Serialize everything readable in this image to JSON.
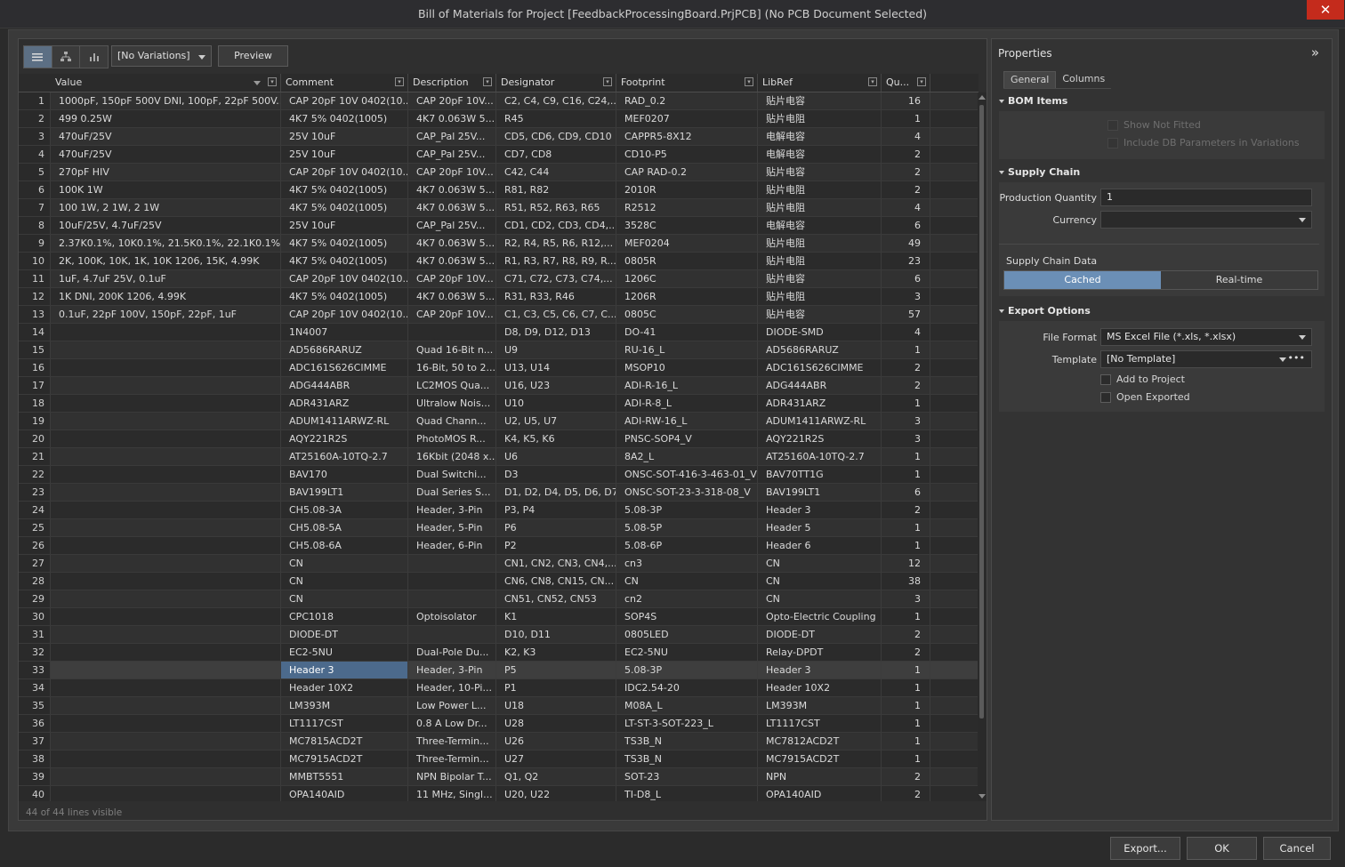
{
  "window": {
    "title": "Bill of Materials for Project [FeedbackProcessingBoard.PrjPCB] (No PCB Document Selected)",
    "close": "✕"
  },
  "toolbar": {
    "variation": "[No Variations]",
    "preview": "Preview"
  },
  "grid": {
    "columns": [
      "Value",
      "Comment",
      "Description",
      "Designator",
      "Footprint",
      "LibRef",
      "Qu..."
    ],
    "rows": [
      [
        "1",
        "1000pF, 150pF 500V DNI, 100pF, 22pF 500V...",
        "CAP 20pF 10V 0402(10...",
        "CAP 20pF 10V...",
        "C2, C4, C9, C16, C24,...",
        "RAD_0.2",
        "贴片电容",
        "16"
      ],
      [
        "2",
        "499 0.25W",
        "4K7 5% 0402(1005)",
        "4K7 0.063W 5...",
        "R45",
        "MEF0207",
        "贴片电阻",
        "1"
      ],
      [
        "3",
        "470uF/25V",
        "25V 10uF",
        "CAP_Pal  25V...",
        "CD5, CD6, CD9, CD10",
        "CAPPR5-8X12",
        "电解电容",
        "4"
      ],
      [
        "4",
        "470uF/25V",
        "25V 10uF",
        "CAP_Pal  25V...",
        "CD7, CD8",
        "CD10-P5",
        "电解电容",
        "2"
      ],
      [
        "5",
        "270pF HIV",
        "CAP 20pF 10V 0402(10...",
        "CAP 20pF 10V...",
        "C42, C44",
        "CAP RAD-0.2",
        "贴片电容",
        "2"
      ],
      [
        "6",
        "100K 1W",
        "4K7 5% 0402(1005)",
        "4K7 0.063W 5...",
        "R81, R82",
        "2010R",
        "贴片电阻",
        "2"
      ],
      [
        "7",
        "100 1W, 2  1W, 2 1W",
        "4K7 5% 0402(1005)",
        "4K7 0.063W 5...",
        "R51, R52, R63, R65",
        "R2512",
        "贴片电阻",
        "4"
      ],
      [
        "8",
        "10uF/25V, 4.7uF/25V",
        "25V 10uF",
        "CAP_Pal  25V...",
        "CD1, CD2, CD3, CD4,...",
        "3528C",
        "电解电容",
        "6"
      ],
      [
        "9",
        "2.37K0.1%, 10K0.1%, 21.5K0.1%, 22.1K0.1%, 2...",
        "4K7 5% 0402(1005)",
        "4K7 0.063W 5...",
        "R2, R4, R5, R6, R12,...",
        "MEF0204",
        "贴片电阻",
        "49"
      ],
      [
        "10",
        "2K, 100K, 10K, 1K, 10K  1206, 15K, 4.99K",
        "4K7 5% 0402(1005)",
        "4K7 0.063W 5...",
        "R1, R3, R7, R8, R9, R...",
        "0805R",
        "贴片电阻",
        "23"
      ],
      [
        "11",
        "1uF, 4.7uF 25V, 0.1uF",
        "CAP 20pF 10V 0402(10...",
        "CAP 20pF 10V...",
        "C71, C72, C73, C74,...",
        "1206C",
        "贴片电容",
        "6"
      ],
      [
        "12",
        "1K   DNI, 200K 1206, 4.99K",
        "4K7 5% 0402(1005)",
        "4K7 0.063W 5...",
        "R31, R33, R46",
        "1206R",
        "贴片电阻",
        "3"
      ],
      [
        "13",
        "0.1uF, 22pF 100V, 150pF, 22pF, 1uF",
        "CAP 20pF 10V 0402(10...",
        "CAP 20pF 10V...",
        "C1, C3, C5, C6, C7, C...",
        "0805C",
        "贴片电容",
        "57"
      ],
      [
        "14",
        "",
        "1N4007",
        "",
        "D8, D9, D12, D13",
        "DO-41",
        "DIODE-SMD",
        "4"
      ],
      [
        "15",
        "",
        "AD5686RARUZ",
        "Quad 16-Bit n...",
        "U9",
        "RU-16_L",
        "AD5686RARUZ",
        "1"
      ],
      [
        "16",
        "",
        "ADC161S626CIMME",
        "16-Bit, 50 to 2...",
        "U13, U14",
        "MSOP10",
        "ADC161S626CIMME",
        "2"
      ],
      [
        "17",
        "",
        "ADG444ABR",
        "LC2MOS Qua...",
        "U16, U23",
        "ADI-R-16_L",
        "ADG444ABR",
        "2"
      ],
      [
        "18",
        "",
        "ADR431ARZ",
        "Ultralow Nois...",
        "U10",
        "ADI-R-8_L",
        "ADR431ARZ",
        "1"
      ],
      [
        "19",
        "",
        "ADUM1411ARWZ-RL",
        "Quad Chann...",
        "U2, U5, U7",
        "ADI-RW-16_L",
        "ADUM1411ARWZ-RL",
        "3"
      ],
      [
        "20",
        "",
        "AQY221R2S",
        "PhotoMOS R...",
        "K4, K5, K6",
        "PNSC-SOP4_V",
        "AQY221R2S",
        "3"
      ],
      [
        "21",
        "",
        "AT25160A-10TQ-2.7",
        "16Kbit (2048 x...",
        "U6",
        "8A2_L",
        "AT25160A-10TQ-2.7",
        "1"
      ],
      [
        "22",
        "",
        "BAV170",
        "Dual Switchi...",
        "D3",
        "ONSC-SOT-416-3-463-01_V",
        "BAV70TT1G",
        "1"
      ],
      [
        "23",
        "",
        "BAV199LT1",
        "Dual Series S...",
        "D1, D2, D4, D5, D6, D7",
        "ONSC-SOT-23-3-318-08_V",
        "BAV199LT1",
        "6"
      ],
      [
        "24",
        "",
        "CH5.08-3A",
        "Header, 3-Pin",
        "P3, P4",
        "5.08-3P",
        "Header 3",
        "2"
      ],
      [
        "25",
        "",
        "CH5.08-5A",
        "Header, 5-Pin",
        "P6",
        "5.08-5P",
        "Header 5",
        "1"
      ],
      [
        "26",
        "",
        "CH5.08-6A",
        "Header, 6-Pin",
        "P2",
        "5.08-6P",
        "Header 6",
        "1"
      ],
      [
        "27",
        "",
        "CN",
        "",
        "CN1, CN2, CN3, CN4,...",
        "cn3",
        "CN",
        "12"
      ],
      [
        "28",
        "",
        "CN",
        "",
        "CN6, CN8, CN15, CN...",
        "CN",
        "CN",
        "38"
      ],
      [
        "29",
        "",
        "CN",
        "",
        "CN51, CN52, CN53",
        "cn2",
        "CN",
        "3"
      ],
      [
        "30",
        "",
        "CPC1018",
        "Optoisolator",
        "K1",
        "SOP4S",
        "Opto-Electric Coupling",
        "1"
      ],
      [
        "31",
        "",
        "DIODE-DT",
        "",
        "D10, D11",
        "0805LED",
        "DIODE-DT",
        "2"
      ],
      [
        "32",
        "",
        "EC2-5NU",
        "Dual-Pole Du...",
        "K2, K3",
        "EC2-5NU",
        "Relay-DPDT",
        "2"
      ],
      [
        "33",
        "",
        "Header 3",
        "Header, 3-Pin",
        "P5",
        "5.08-3P",
        "Header 3",
        "1"
      ],
      [
        "34",
        "",
        "Header 10X2",
        "Header, 10-Pi...",
        "P1",
        "IDC2.54-20",
        "Header 10X2",
        "1"
      ],
      [
        "35",
        "",
        "LM393M",
        "Low Power L...",
        "U18",
        "M08A_L",
        "LM393M",
        "1"
      ],
      [
        "36",
        "",
        "LT1117CST",
        "0.8 A Low Dr...",
        "U28",
        "LT-ST-3-SOT-223_L",
        "LT1117CST",
        "1"
      ],
      [
        "37",
        "",
        "MC7815ACD2T",
        "Three-Termin...",
        "U26",
        "TS3B_N",
        "MC7812ACD2T",
        "1"
      ],
      [
        "38",
        "",
        "MC7915ACD2T",
        "Three-Termin...",
        "U27",
        "TS3B_N",
        "MC7915ACD2T",
        "1"
      ],
      [
        "39",
        "",
        "MMBT5551",
        "NPN Bipolar T...",
        "Q1, Q2",
        "SOT-23",
        "NPN",
        "2"
      ],
      [
        "40",
        "",
        "OPA140AID",
        "11 MHz, Singl...",
        "U20, U22",
        "TI-D8_L",
        "OPA140AID",
        "2"
      ]
    ],
    "selected_row": 33,
    "status": "44 of 44 lines visible"
  },
  "properties": {
    "title": "Properties",
    "collapse": "»",
    "tabs": [
      "General",
      "Columns"
    ],
    "bom_items": {
      "title": "BOM Items",
      "show_not_fitted": "Show Not Fitted",
      "include_db": "Include DB Parameters in Variations"
    },
    "supply_chain": {
      "title": "Supply Chain",
      "production_qty_label": "Production Quantity",
      "production_qty": "1",
      "currency_label": "Currency",
      "currency": "",
      "data_label": "Supply Chain Data",
      "cached": "Cached",
      "realtime": "Real-time"
    },
    "export": {
      "title": "Export Options",
      "file_format_label": "File Format",
      "file_format": "MS Excel File (*.xls, *.xlsx)",
      "template_label": "Template",
      "template": "[No Template]",
      "more": "•••",
      "add_to_project": "Add to Project",
      "open_exported": "Open Exported"
    }
  },
  "buttons": {
    "export": "Export...",
    "ok": "OK",
    "cancel": "Cancel"
  }
}
